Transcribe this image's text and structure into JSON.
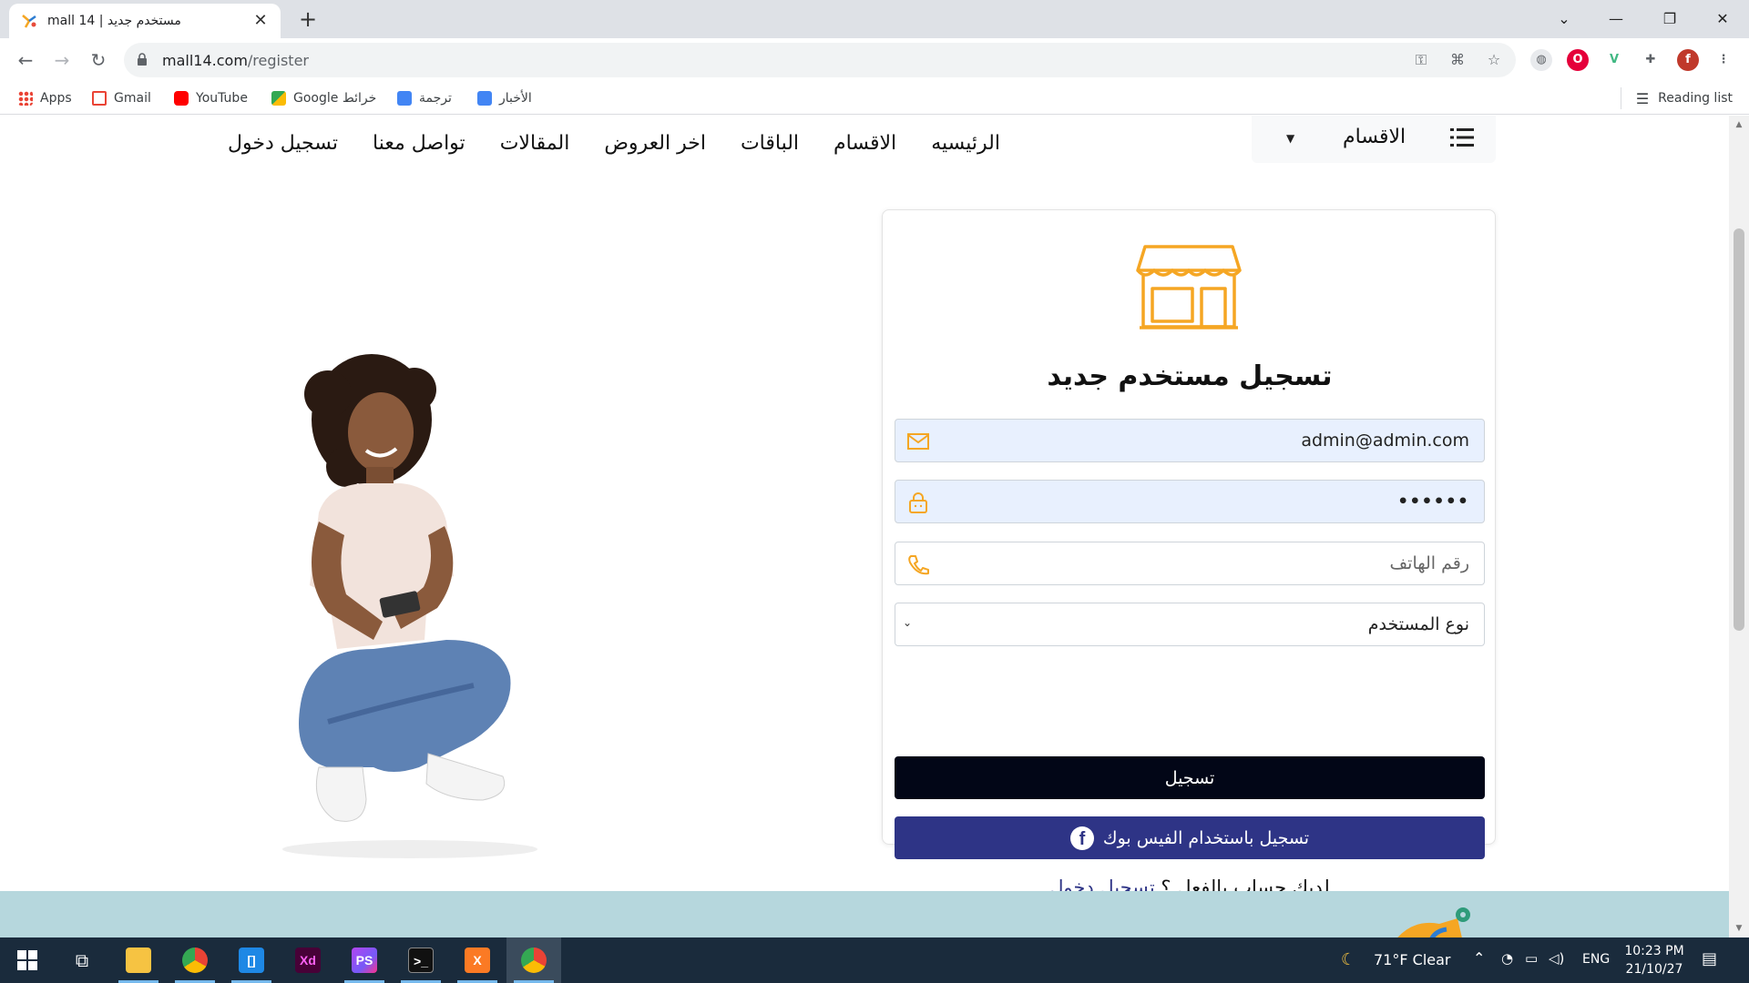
{
  "browser": {
    "tab_title": "mall 14 | مستخدم جديد",
    "url_host": "mall14.com",
    "url_path": "/register",
    "bookmarks": [
      "Apps",
      "Gmail",
      "YouTube",
      "Google خرائط",
      "ترجمة",
      "الأخبار"
    ],
    "reading_list": "Reading list",
    "profile_initial": "f"
  },
  "site_nav": {
    "categories_dropdown": "الاقسام",
    "links": [
      "الرئيسيه",
      "الاقسام",
      "الباقات",
      "اخر العروض",
      "المقالات",
      "تواصل معنا",
      "تسجيل دخول"
    ]
  },
  "form": {
    "title": "تسجيل مستخدم جديد",
    "email_value": "admin@admin.com",
    "password_value": "••••••",
    "phone_placeholder": "رقم الهاتف",
    "user_type_selected": "نوع المستخدم",
    "register_button": "تسجيل",
    "facebook_button": "تسجيل باستخدام الفيس بوك",
    "have_account_text": "لديك حساب بالفعل ؟",
    "login_link": "تسجيل دخول"
  },
  "colors": {
    "accent_gold": "#f5a623",
    "primary_dark": "#020617",
    "facebook": "#2e3486",
    "footer_band": "#b6d7dd"
  },
  "taskbar": {
    "weather": "71°F  Clear",
    "language": "ENG",
    "time": "10:23 PM",
    "date": "21/10/27"
  }
}
